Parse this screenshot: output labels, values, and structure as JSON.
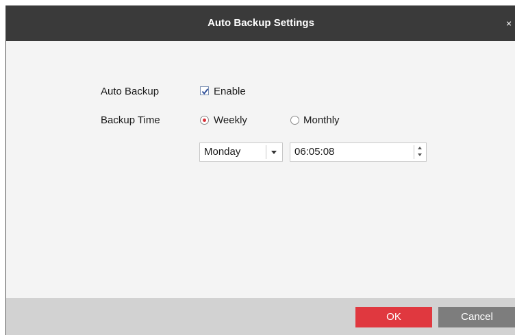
{
  "window": {
    "title": "Auto Backup Settings",
    "close_glyph": "×"
  },
  "form": {
    "auto_backup": {
      "label": "Auto Backup",
      "checkbox_label": "Enable",
      "checked": true
    },
    "backup_time": {
      "label": "Backup Time",
      "options": [
        {
          "label": "Weekly",
          "selected": true
        },
        {
          "label": "Monthly",
          "selected": false
        }
      ],
      "day_select": {
        "value": "Monday"
      },
      "time_field": {
        "value": "06:05:08"
      }
    }
  },
  "footer": {
    "ok_label": "OK",
    "cancel_label": "Cancel"
  },
  "colors": {
    "accent": "#e0383f",
    "titlebar": "#3a3a3a",
    "cancel": "#7d7d7d"
  },
  "icons": [
    "checkmark-icon",
    "dropdown-arrow-icon",
    "spin-up-icon",
    "spin-down-icon",
    "close-icon"
  ]
}
